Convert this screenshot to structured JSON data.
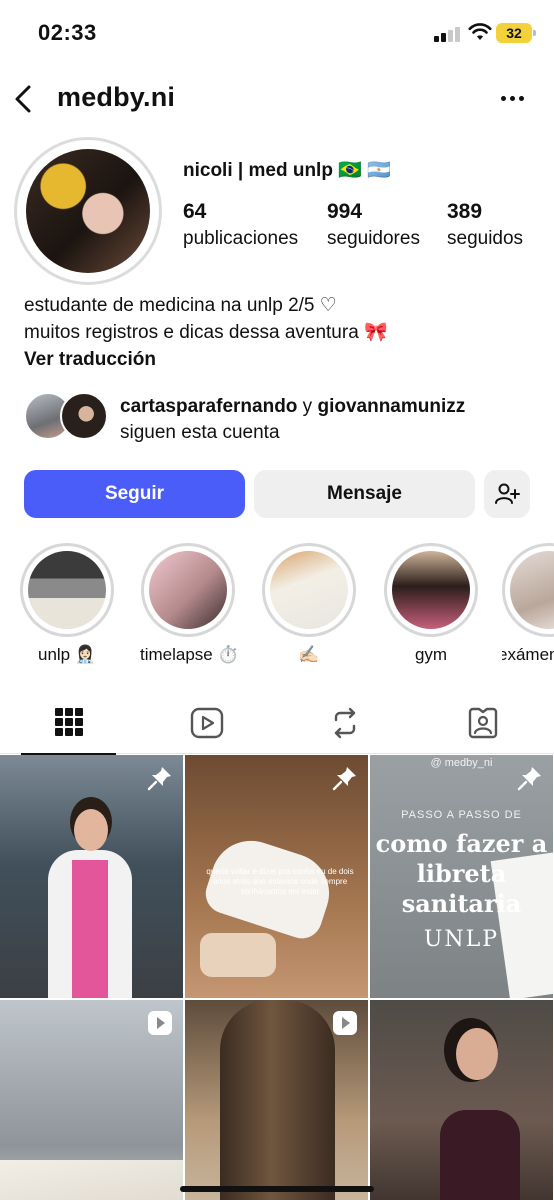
{
  "status_bar": {
    "time": "02:33",
    "battery": "32",
    "battery_color": "#f2d13a"
  },
  "header": {
    "username": "medby.ni",
    "back_icon": "chevron-left-icon",
    "more_icon": "more-horizontal-icon"
  },
  "profile": {
    "display_name": "nicoli | med unlp 🇧🇷 🇦🇷",
    "stats": [
      {
        "value": "64",
        "label": "publicaciones"
      },
      {
        "value": "994",
        "label": "seguidores"
      },
      {
        "value": "389",
        "label": "seguidos"
      }
    ],
    "bio_line1": "estudante de medicina na unlp 2/5 ♡",
    "bio_line2": "muitos registros e dicas dessa aventura 🎀",
    "translate_label": "Ver traducción"
  },
  "followed_by": {
    "user1": "cartasparafernando",
    "connector": " y ",
    "user2": "giovannamunizz",
    "suffix": "siguen esta cuenta"
  },
  "actions": {
    "follow_label": "Seguir",
    "message_label": "Mensaje",
    "add_user_icon": "person-add-icon",
    "accent_color": "#4a5df9"
  },
  "highlights": [
    {
      "label": "unlp 👩🏻‍⚕️"
    },
    {
      "label": "timelapse ⏱️"
    },
    {
      "label": "✍🏻"
    },
    {
      "label": "gym"
    },
    {
      "label": "exámen"
    }
  ],
  "tabs": [
    {
      "icon": "grid-icon",
      "active": true
    },
    {
      "icon": "reels-icon",
      "active": false
    },
    {
      "icon": "reposts-icon",
      "active": false
    },
    {
      "icon": "tagged-icon",
      "active": false
    }
  ],
  "grid_posts": {
    "post2_caption": "queria voltar e dizer pra minha eu de dois anos atrás que estamos onde sempre sonhávamos em estar",
    "post3_handle": "@ medby_ni",
    "post3_subtitle": "PASSO A PASSO DE",
    "post3_title": "como fazer a libreta sanitaria",
    "post3_footer": "UNLP"
  }
}
